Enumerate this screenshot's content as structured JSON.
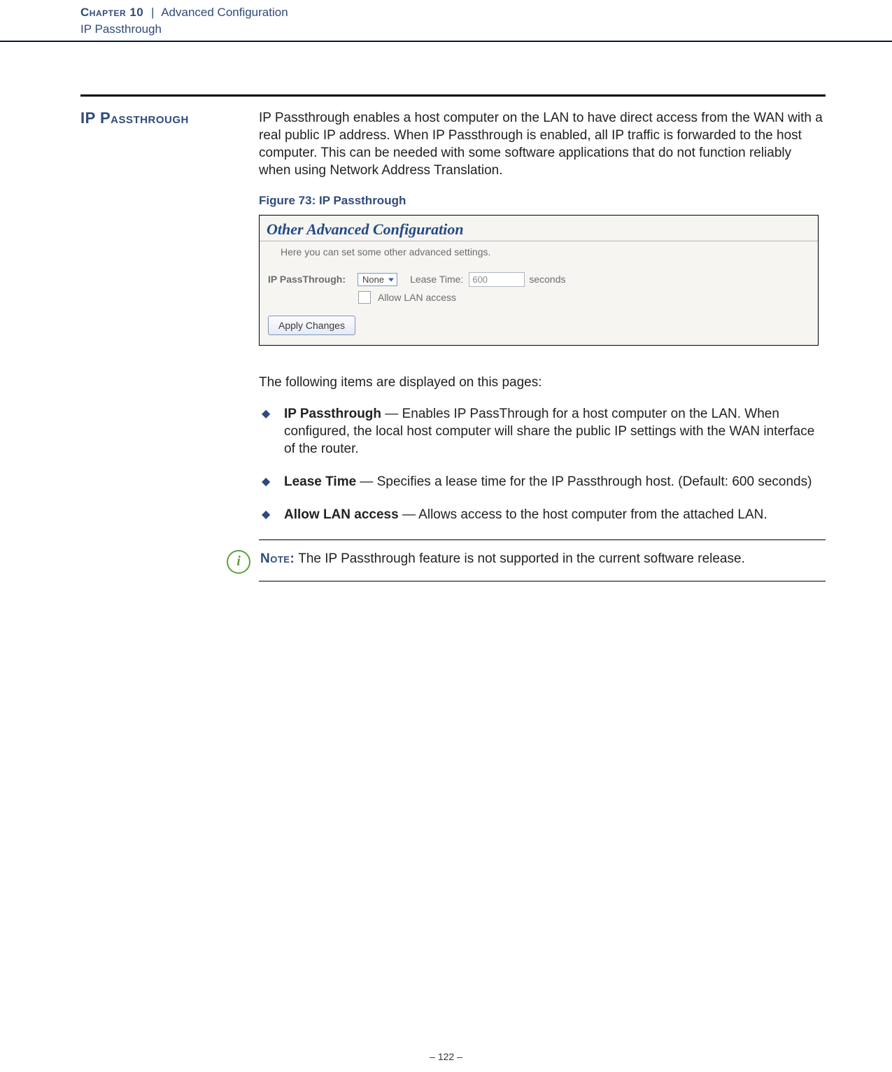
{
  "header": {
    "chapter": "Chapter 10",
    "separator": "|",
    "title": "Advanced Configuration",
    "subtitle": "IP Passthrough"
  },
  "section_heading": "IP Passthrough",
  "intro": "IP Passthrough enables a host computer on the LAN to have direct access from the WAN with a real public IP address. When IP Passthrough is enabled, all IP traffic is forwarded to the host computer. This can be needed with some software applications that do not function reliably when using Network Address Translation.",
  "figure_caption": "Figure 73:  IP Passthrough",
  "screenshot": {
    "panel_title": "Other Advanced Configuration",
    "panel_sub": "Here you can set some other advanced settings.",
    "label_passthrough": "IP PassThrough:",
    "select_value": "None",
    "label_lease": "Lease Time:",
    "lease_value": "600",
    "lease_unit": "seconds",
    "allow_lan_label": "Allow LAN access",
    "apply_button": "Apply Changes"
  },
  "lead_line": "The following items are displayed on this pages:",
  "bullets": [
    {
      "title": "IP Passthrough",
      "desc": " — Enables IP PassThrough for a host computer on the LAN. When configured, the local host computer will share the public IP settings with the WAN interface of the router."
    },
    {
      "title": "Lease Time",
      "desc": " — Specifies a lease time for the IP Passthrough host. (Default: 600 seconds)"
    },
    {
      "title": "Allow LAN access",
      "desc": " — Allows access to the host computer from the attached LAN."
    }
  ],
  "note": {
    "label": "Note:",
    "text": " The IP Passthrough feature is not supported in the current software release."
  },
  "page_number": "–  122  –"
}
